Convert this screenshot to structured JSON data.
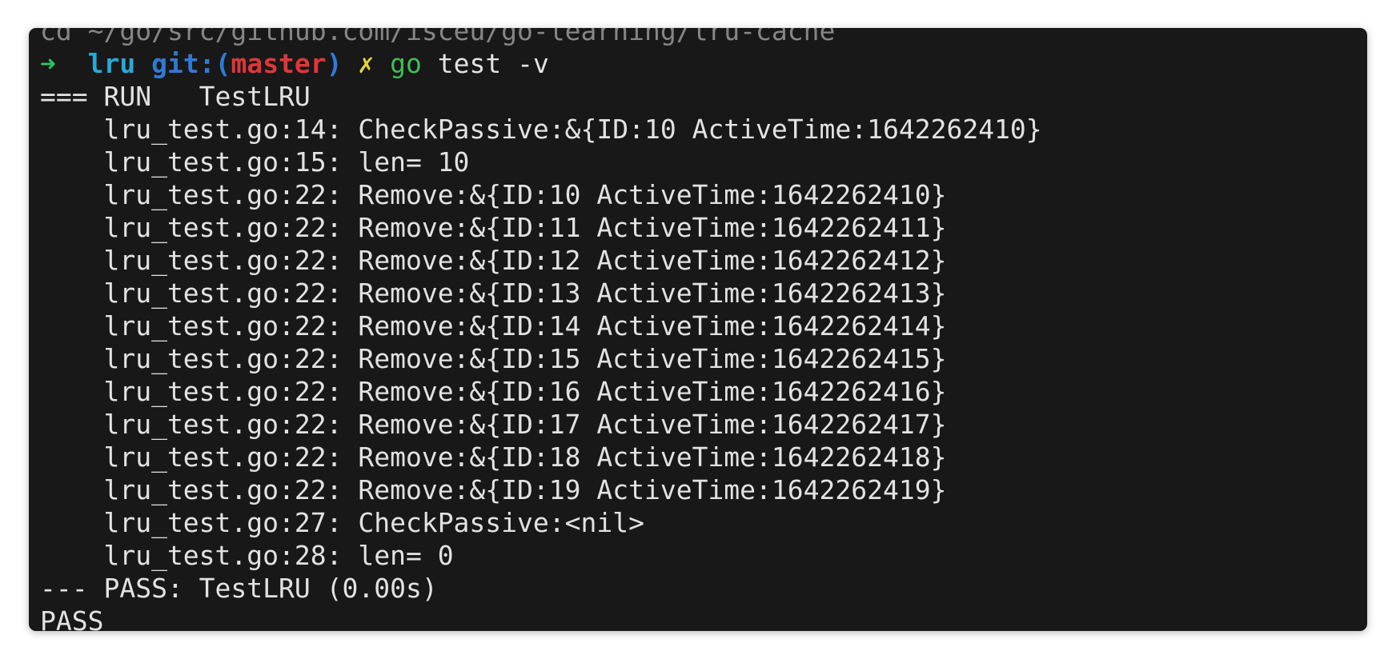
{
  "terminal": {
    "cut_line": "cd ~/go/src/github.com/isceu/go-learning/lru-cache",
    "prompt": {
      "arrow": "➜",
      "directory": "lru",
      "git_label": "git:(",
      "branch": "master",
      "git_close": ")",
      "dirty_mark": "✗",
      "command": "go",
      "args": "test -v"
    },
    "output": [
      "=== RUN   TestLRU",
      "    lru_test.go:14: CheckPassive:&{ID:10 ActiveTime:1642262410}",
      "    lru_test.go:15: len= 10",
      "    lru_test.go:22: Remove:&{ID:10 ActiveTime:1642262410}",
      "    lru_test.go:22: Remove:&{ID:11 ActiveTime:1642262411}",
      "    lru_test.go:22: Remove:&{ID:12 ActiveTime:1642262412}",
      "    lru_test.go:22: Remove:&{ID:13 ActiveTime:1642262413}",
      "    lru_test.go:22: Remove:&{ID:14 ActiveTime:1642262414}",
      "    lru_test.go:22: Remove:&{ID:15 ActiveTime:1642262415}",
      "    lru_test.go:22: Remove:&{ID:16 ActiveTime:1642262416}",
      "    lru_test.go:22: Remove:&{ID:17 ActiveTime:1642262417}",
      "    lru_test.go:22: Remove:&{ID:18 ActiveTime:1642262418}",
      "    lru_test.go:22: Remove:&{ID:19 ActiveTime:1642262419}",
      "    lru_test.go:27: CheckPassive:<nil>",
      "    lru_test.go:28: len= 0",
      "--- PASS: TestLRU (0.00s)",
      "PASS"
    ]
  },
  "colors": {
    "background": "#181818",
    "text": "#e2e2e2",
    "arrow": "#2fbf63",
    "directory": "#27a9d6",
    "git_label": "#2f7ad8",
    "branch": "#e0363b",
    "dirty_mark": "#e8d43b",
    "command": "#3fbf55"
  }
}
